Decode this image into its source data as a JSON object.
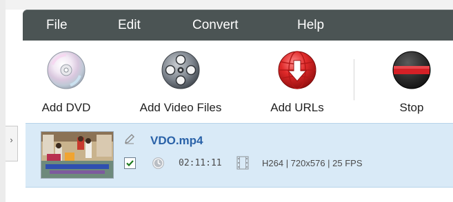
{
  "menu": {
    "items": [
      {
        "label": "File"
      },
      {
        "label": "Edit"
      },
      {
        "label": "Convert"
      },
      {
        "label": "Help"
      }
    ]
  },
  "toolbar": {
    "add_dvd_label": "Add DVD",
    "add_video_files_label": "Add Video Files",
    "add_urls_label": "Add URLs",
    "stop_label": "Stop"
  },
  "file_list": {
    "items": [
      {
        "filename": "VDO.mp4",
        "checked": true,
        "duration": "02:11:11",
        "info": "H264 | 720x576 | 25 FPS"
      }
    ]
  },
  "colors": {
    "menubar": "#4b5454",
    "row_selected": "#d9eaf7",
    "filename": "#2a62a8",
    "stop_red": "#d42026"
  }
}
